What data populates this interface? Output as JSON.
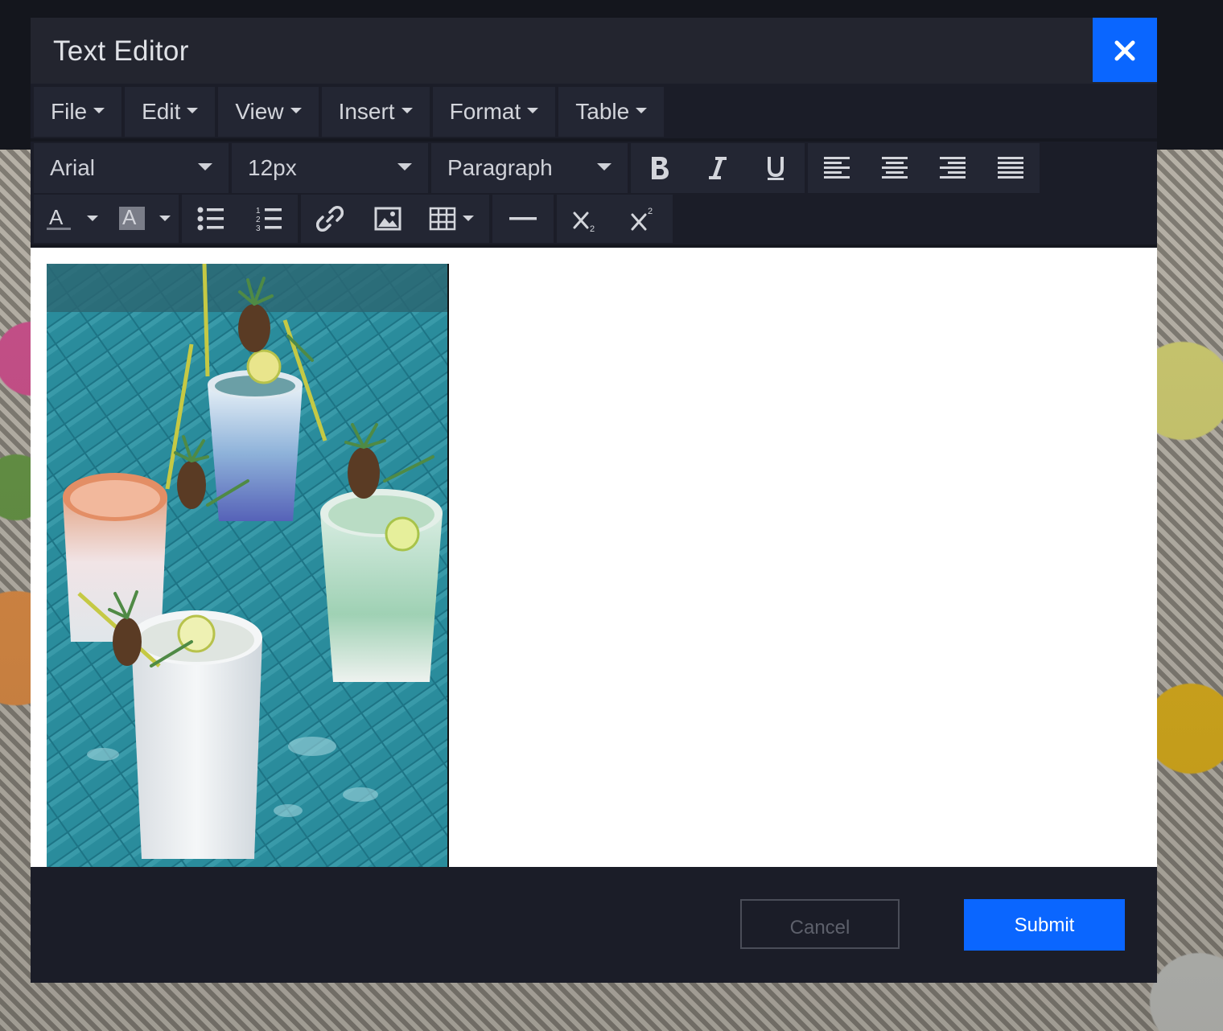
{
  "dialog": {
    "title": "Text Editor",
    "close_icon": "close-icon",
    "accent_color": "#0a66ff"
  },
  "menubar": {
    "items": [
      {
        "label": "File"
      },
      {
        "label": "Edit"
      },
      {
        "label": "View"
      },
      {
        "label": "Insert"
      },
      {
        "label": "Format"
      },
      {
        "label": "Table"
      }
    ]
  },
  "toolbar": {
    "font_family": "Arial",
    "font_size": "12px",
    "block_format": "Paragraph",
    "icons_row1": [
      "bold-icon",
      "italic-icon",
      "underline-icon",
      "align-left-icon",
      "align-center-icon",
      "align-right-icon",
      "align-justify-icon"
    ],
    "icons_row2": [
      "text-color-icon",
      "background-color-icon",
      "bullet-list-icon",
      "numbered-list-icon",
      "link-icon",
      "image-icon",
      "table-icon",
      "horizontal-rule-icon",
      "subscript-icon",
      "superscript-icon"
    ]
  },
  "content": {
    "image_subject": "four cocktails in ceramic cups with pineapple garnish on teal tile table"
  },
  "footer": {
    "cancel_label": "Cancel",
    "submit_label": "Submit"
  }
}
